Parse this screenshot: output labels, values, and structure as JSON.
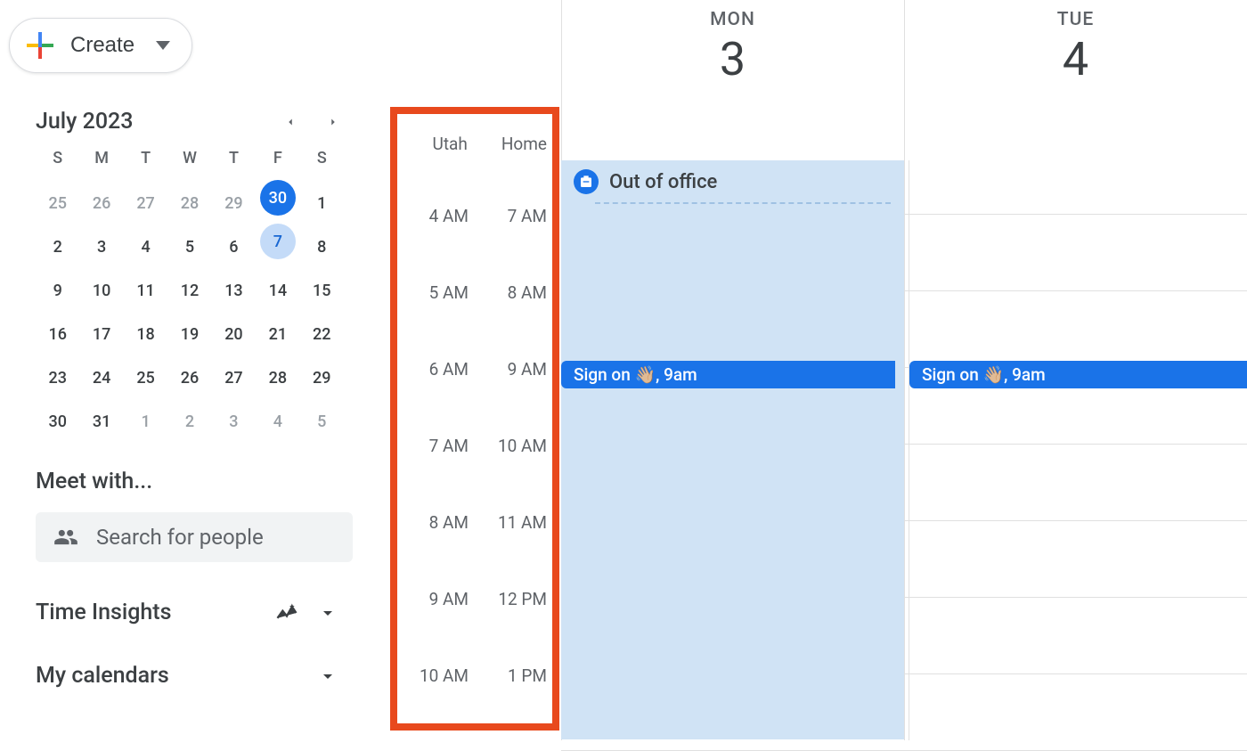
{
  "create_button": {
    "label": "Create"
  },
  "mini_calendar": {
    "title": "July 2023",
    "dow": [
      "S",
      "M",
      "T",
      "W",
      "T",
      "F",
      "S"
    ],
    "weeks": [
      [
        {
          "n": "25",
          "muted": true
        },
        {
          "n": "26",
          "muted": true
        },
        {
          "n": "27",
          "muted": true
        },
        {
          "n": "28",
          "muted": true
        },
        {
          "n": "29",
          "muted": true
        },
        {
          "n": "30",
          "today": true
        },
        {
          "n": "1"
        }
      ],
      [
        {
          "n": "2"
        },
        {
          "n": "3"
        },
        {
          "n": "4"
        },
        {
          "n": "5"
        },
        {
          "n": "6"
        },
        {
          "n": "7",
          "selected": true
        },
        {
          "n": "8"
        }
      ],
      [
        {
          "n": "9"
        },
        {
          "n": "10"
        },
        {
          "n": "11"
        },
        {
          "n": "12"
        },
        {
          "n": "13"
        },
        {
          "n": "14"
        },
        {
          "n": "15"
        }
      ],
      [
        {
          "n": "16"
        },
        {
          "n": "17"
        },
        {
          "n": "18"
        },
        {
          "n": "19"
        },
        {
          "n": "20"
        },
        {
          "n": "21"
        },
        {
          "n": "22"
        }
      ],
      [
        {
          "n": "23"
        },
        {
          "n": "24"
        },
        {
          "n": "25"
        },
        {
          "n": "26"
        },
        {
          "n": "27"
        },
        {
          "n": "28"
        },
        {
          "n": "29"
        }
      ],
      [
        {
          "n": "30"
        },
        {
          "n": "31"
        },
        {
          "n": "1",
          "muted": true
        },
        {
          "n": "2",
          "muted": true
        },
        {
          "n": "3",
          "muted": true
        },
        {
          "n": "4",
          "muted": true
        },
        {
          "n": "5",
          "muted": true
        }
      ]
    ]
  },
  "meet_with": {
    "title": "Meet with...",
    "placeholder": "Search for people"
  },
  "time_insights": {
    "title": "Time Insights"
  },
  "my_calendars": {
    "title": "My calendars"
  },
  "timezones": {
    "labels": [
      "Utah",
      "Home"
    ],
    "rows": [
      [
        "4 AM",
        "7 AM"
      ],
      [
        "5 AM",
        "8 AM"
      ],
      [
        "6 AM",
        "9 AM"
      ],
      [
        "7 AM",
        "10 AM"
      ],
      [
        "8 AM",
        "11 AM"
      ],
      [
        "9 AM",
        "12 PM"
      ],
      [
        "10 AM",
        "1 PM"
      ]
    ]
  },
  "days": [
    {
      "dow": "MON",
      "num": "3"
    },
    {
      "dow": "TUE",
      "num": "4"
    }
  ],
  "out_of_office": {
    "title": "Out of office"
  },
  "events": {
    "sign_on_mon": "Sign on 👋🏼, 9am",
    "sign_on_tue": "Sign on 👋🏼, 9am"
  }
}
